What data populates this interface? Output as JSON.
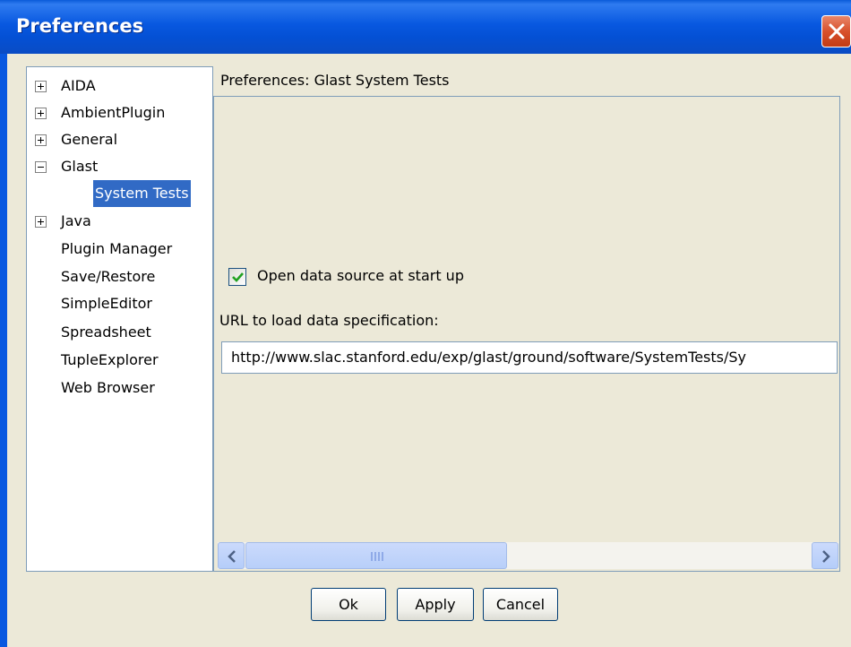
{
  "window": {
    "title": "Preferences"
  },
  "tree": {
    "items": [
      {
        "label": "AIDA",
        "expander": "plus"
      },
      {
        "label": "AmbientPlugin",
        "expander": "plus"
      },
      {
        "label": "General",
        "expander": "plus"
      },
      {
        "label": "Glast",
        "expander": "minus"
      },
      {
        "label": "System Tests",
        "expander": "none",
        "selected": true
      },
      {
        "label": "Java",
        "expander": "plus"
      },
      {
        "label": "Plugin Manager",
        "expander": "none"
      },
      {
        "label": "Save/Restore",
        "expander": "none"
      },
      {
        "label": "SimpleEditor",
        "expander": "none"
      },
      {
        "label": "Spreadsheet",
        "expander": "none"
      },
      {
        "label": "TupleExplorer",
        "expander": "none"
      },
      {
        "label": "Web Browser",
        "expander": "none"
      }
    ]
  },
  "panel": {
    "header": "Preferences: Glast System Tests",
    "checkbox_label": "Open data source at start up",
    "checkbox_checked": true,
    "url_label": "URL to load data specification:",
    "url_value": "http://www.slac.stanford.edu/exp/glast/ground/software/SystemTests/Sy"
  },
  "buttons": {
    "ok": "Ok",
    "apply": "Apply",
    "cancel": "Cancel"
  },
  "colors": {
    "titlebar": "#0858e0",
    "selection": "#316ac5",
    "checkmark": "#21a121"
  },
  "icons": {
    "close": "close-icon",
    "scroll_left": "chevron-left-icon",
    "scroll_right": "chevron-right-icon",
    "check": "checkmark-icon"
  }
}
